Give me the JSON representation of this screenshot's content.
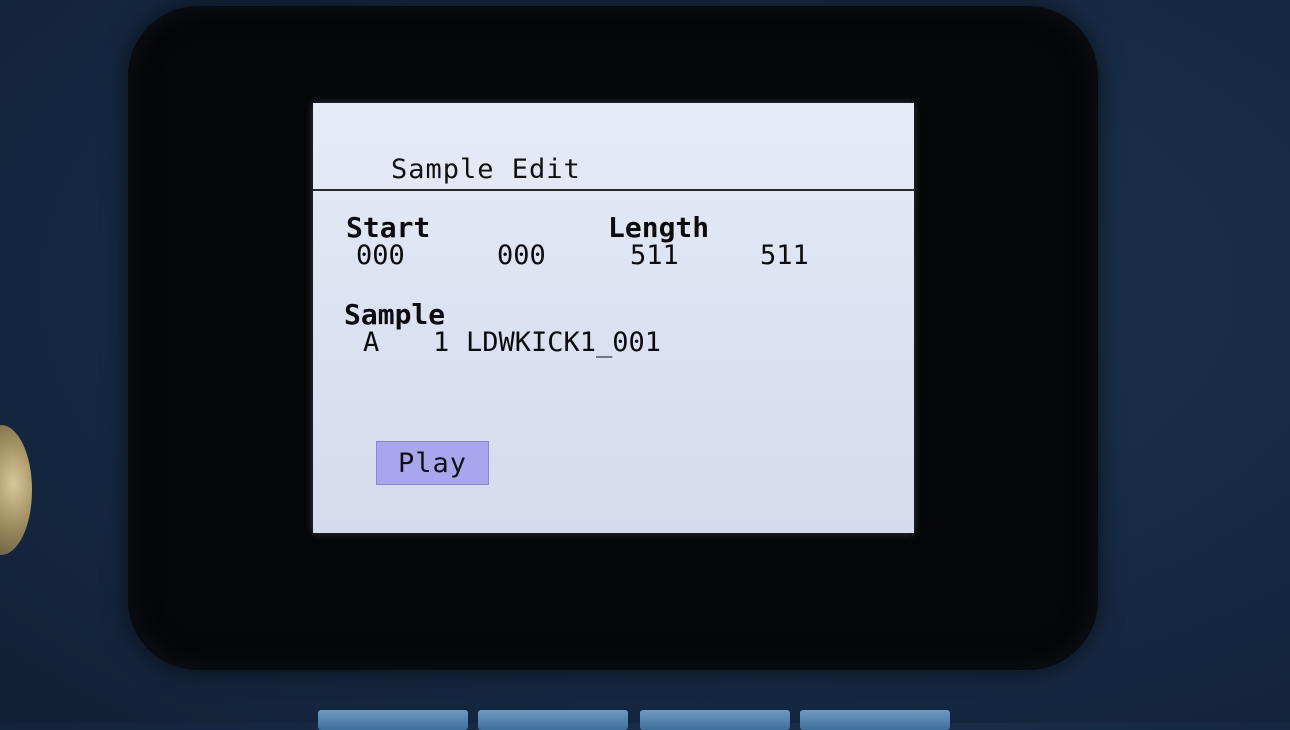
{
  "screen": {
    "title": "Sample Edit",
    "start": {
      "label": "Start",
      "value1": "000",
      "value2": "000"
    },
    "length": {
      "label": "Length",
      "value1": "511",
      "value2": "511"
    },
    "sample": {
      "label": "Sample",
      "bank": "A",
      "number": "1",
      "name": "LDWKICK1_001"
    },
    "play_label": "Play"
  },
  "colors": {
    "lcd_background": "#dfe4f3",
    "play_button": "#a9a6ee",
    "hardware_button": "#4f7fab"
  }
}
